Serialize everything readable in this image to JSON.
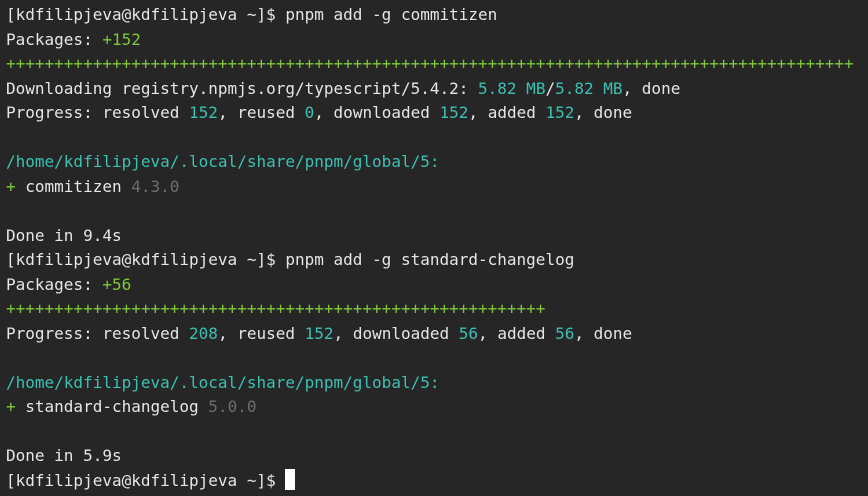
{
  "theme": {
    "background": "#262626",
    "default_fg": "#e6e6e6",
    "green": "#7ec83a",
    "cyan": "#3cc0b4",
    "gray": "#6e6e6e"
  },
  "lines": [
    {
      "segments": [
        {
          "t": "[kdfilipjeva@kdfilipjeva ~]$ pnpm add -g commitizen",
          "c": "default"
        }
      ]
    },
    {
      "segments": [
        {
          "t": "Packages: ",
          "c": "default"
        },
        {
          "t": "+152",
          "c": "green"
        }
      ]
    },
    {
      "segments": [
        {
          "t": "++++++++++++++++++++++++++++++++++++++++++++++++++++++++++++++++++++++++++++++++++++++++",
          "c": "green"
        }
      ]
    },
    {
      "segments": [
        {
          "t": "Downloading registry.npmjs.org/typescript/5.4.2: ",
          "c": "default"
        },
        {
          "t": "5.82 MB",
          "c": "cyan"
        },
        {
          "t": "/",
          "c": "default"
        },
        {
          "t": "5.82 MB",
          "c": "cyan"
        },
        {
          "t": ", done",
          "c": "default"
        }
      ]
    },
    {
      "segments": [
        {
          "t": "Progress: resolved ",
          "c": "default"
        },
        {
          "t": "152",
          "c": "cyan"
        },
        {
          "t": ", reused ",
          "c": "default"
        },
        {
          "t": "0",
          "c": "cyan"
        },
        {
          "t": ", downloaded ",
          "c": "default"
        },
        {
          "t": "152",
          "c": "cyan"
        },
        {
          "t": ", added ",
          "c": "default"
        },
        {
          "t": "152",
          "c": "cyan"
        },
        {
          "t": ", done",
          "c": "default"
        }
      ]
    },
    {
      "segments": []
    },
    {
      "segments": [
        {
          "t": "/home/kdfilipjeva/.local/share/pnpm/global/5:",
          "c": "cyan"
        }
      ]
    },
    {
      "segments": [
        {
          "t": "+ ",
          "c": "green"
        },
        {
          "t": "commitizen ",
          "c": "default"
        },
        {
          "t": "4.3.0",
          "c": "gray"
        }
      ]
    },
    {
      "segments": []
    },
    {
      "segments": [
        {
          "t": "Done in 9.4s",
          "c": "default"
        }
      ]
    },
    {
      "segments": [
        {
          "t": "[kdfilipjeva@kdfilipjeva ~]$ pnpm add -g standard-changelog",
          "c": "default"
        }
      ]
    },
    {
      "segments": [
        {
          "t": "Packages: ",
          "c": "default"
        },
        {
          "t": "+56",
          "c": "green"
        }
      ]
    },
    {
      "segments": [
        {
          "t": "++++++++++++++++++++++++++++++++++++++++++++++++++++++++",
          "c": "green"
        }
      ]
    },
    {
      "segments": [
        {
          "t": "Progress: resolved ",
          "c": "default"
        },
        {
          "t": "208",
          "c": "cyan"
        },
        {
          "t": ", reused ",
          "c": "default"
        },
        {
          "t": "152",
          "c": "cyan"
        },
        {
          "t": ", downloaded ",
          "c": "default"
        },
        {
          "t": "56",
          "c": "cyan"
        },
        {
          "t": ", added ",
          "c": "default"
        },
        {
          "t": "56",
          "c": "cyan"
        },
        {
          "t": ", done",
          "c": "default"
        }
      ]
    },
    {
      "segments": []
    },
    {
      "segments": [
        {
          "t": "/home/kdfilipjeva/.local/share/pnpm/global/5:",
          "c": "cyan"
        }
      ]
    },
    {
      "segments": [
        {
          "t": "+ ",
          "c": "green"
        },
        {
          "t": "standard-changelog ",
          "c": "default"
        },
        {
          "t": "5.0.0",
          "c": "gray"
        }
      ]
    },
    {
      "segments": []
    },
    {
      "segments": [
        {
          "t": "Done in 5.9s",
          "c": "default"
        }
      ]
    },
    {
      "segments": [
        {
          "t": "[kdfilipjeva@kdfilipjeva ~]$ ",
          "c": "default"
        }
      ],
      "cursor": true
    }
  ]
}
